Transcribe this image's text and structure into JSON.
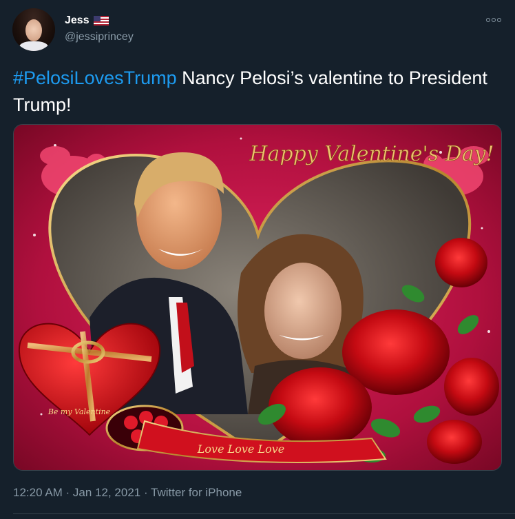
{
  "author": {
    "name": "Jess",
    "handle": "@jessiprincey",
    "avatar_icon": "user-avatar",
    "flag_icon": "us-flag-icon"
  },
  "tweet": {
    "hashtag": "#PelosiLovesTrump",
    "text": " Nancy Pelosi’s valentine to President Trump!"
  },
  "media": {
    "banner_text": "Happy Valentine's Day!",
    "candy_box_text": "Be my Valentine",
    "ribbon_text": "Love Love Love"
  },
  "meta": {
    "timestamp": "12:20 AM · Jan 12, 2021 · Twitter for iPhone"
  },
  "colors": {
    "background": "#15202b",
    "hashtag": "#1d9bf0",
    "secondary_text": "#8899a6",
    "accent_red": "#c8102e"
  }
}
